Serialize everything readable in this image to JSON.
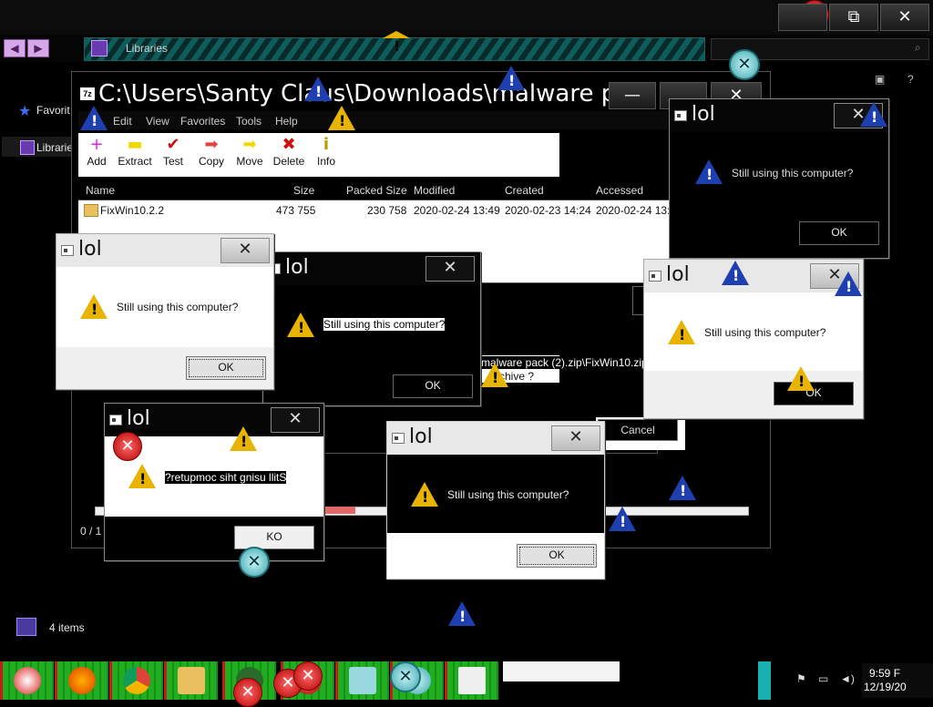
{
  "explorer": {
    "breadcrumb": "Libraries",
    "nav_favorites": "Favorit",
    "nav_libraries": "Librarie",
    "status_items": "4 items",
    "maximize_glyph": "⧉",
    "close_glyph": "✕"
  },
  "zip_window": {
    "title": "C:\\Users\\Santy Claus\\Downloads\\malware pa...",
    "app_badge": "7z",
    "minimize_glyph": "—",
    "close_glyph": "✕",
    "menu": [
      "Edit",
      "View",
      "Favorites",
      "Tools",
      "Help"
    ],
    "toolbar": [
      {
        "label": "Add",
        "icon": "+",
        "color": "#e81ce8"
      },
      {
        "label": "Extract",
        "icon": "▬",
        "color": "#f0d800"
      },
      {
        "label": "Test",
        "icon": "✔",
        "color": "#d01010"
      },
      {
        "label": "Copy",
        "icon": "➡",
        "color": "#e84040"
      },
      {
        "label": "Move",
        "icon": "➡",
        "color": "#f0d800"
      },
      {
        "label": "Delete",
        "icon": "✖",
        "color": "#d01010"
      },
      {
        "label": "Info",
        "icon": "i",
        "color": "#b89a00"
      }
    ],
    "columns": [
      "Name",
      "Size",
      "Packed Size",
      "Modified",
      "Created",
      "Accessed"
    ],
    "rows": [
      {
        "name": "FixWin10.2.2",
        "size": "473 755",
        "packed": "230 758",
        "modified": "2020-02-24 13:49",
        "created": "2020-02-23 14:24",
        "accessed": "2020-02-24 13:4"
      }
    ],
    "progress_counter": "0 / 1",
    "extract_path": "malware pack (2).zip\\FixWin10.zip\\",
    "extract_question": "rchive ?",
    "cancel_label": "Cancel"
  },
  "dialogs": [
    {
      "id": "d1",
      "title": "lol",
      "message": "Still using this computer?",
      "ok": "OK"
    },
    {
      "id": "d2",
      "title": "lol",
      "message": "Still using this computer?",
      "ok": "OK"
    },
    {
      "id": "d3",
      "title": "lol",
      "message": "Still using this computer?",
      "ok": "OK"
    },
    {
      "id": "d4",
      "title": "lol",
      "message": "Still using this computer?",
      "ok": "OK"
    },
    {
      "id": "d5",
      "title": "lol",
      "message": "?retupmoc siht gnisu llitS",
      "ok": "KO"
    },
    {
      "id": "d6",
      "title": "lol",
      "message": "Still using this computer?",
      "ok": "OK"
    }
  ],
  "taskbar": {
    "clock_time": "9:59 F",
    "clock_date": "12/19/20"
  },
  "icons": {
    "warning": "warning-triangle-icon",
    "info": "info-triangle-icon",
    "error": "error-circle-icon",
    "close": "close-x-icon"
  },
  "colors": {
    "address_stripe": "#0d5d5d",
    "taskbar_button": "#1fae1f",
    "warning": "#e8b400",
    "info": "#1e3fb0"
  }
}
